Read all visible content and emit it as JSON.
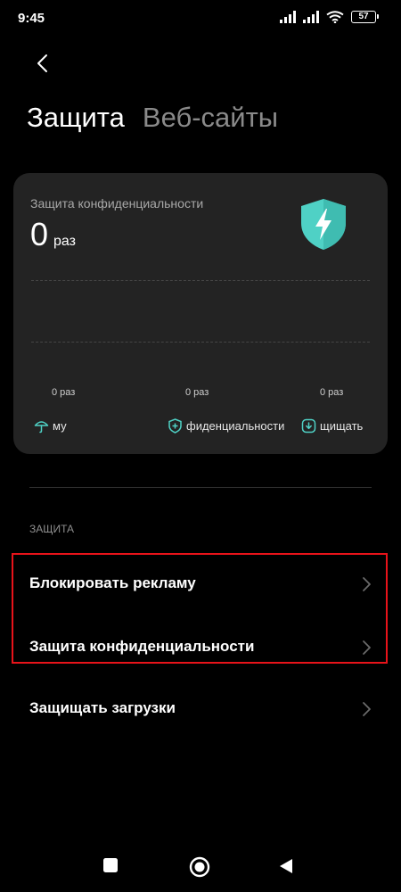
{
  "status_bar": {
    "time": "9:45",
    "battery": "57"
  },
  "tabs": [
    {
      "label": "Защита",
      "active": true
    },
    {
      "label": "Веб-сайты",
      "active": false
    }
  ],
  "card": {
    "title": "Защита конфиденциальности",
    "count": "0",
    "count_unit": "раз",
    "chart_labels": [
      "0 раз",
      "0 раз",
      "0 раз"
    ],
    "legend": [
      {
        "label": "му",
        "icon": "umbrella-icon"
      },
      {
        "label": "фиденциальности",
        "icon": "shield-plus-icon"
      },
      {
        "label": "щищать",
        "icon": "download-shield-icon"
      }
    ],
    "accent_color": "#4fd1c5"
  },
  "section": {
    "header": "ЗАЩИТА",
    "items": [
      {
        "label": "Блокировать рекламу"
      },
      {
        "label": "Защита конфиденциальности"
      },
      {
        "label": "Защищать загрузки"
      }
    ]
  },
  "colors": {
    "background": "#000000",
    "card": "#232323",
    "highlight": "#e8131a"
  }
}
